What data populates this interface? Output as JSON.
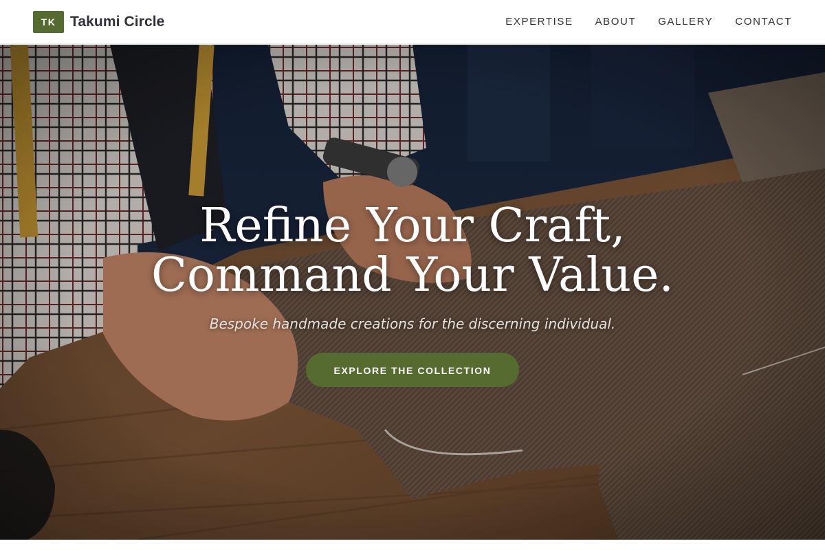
{
  "brand": {
    "logo_text": "TK",
    "name": "Takumi Circle",
    "accent_color": "#556b2f"
  },
  "nav": {
    "items": [
      {
        "label": "EXPERTISE"
      },
      {
        "label": "ABOUT"
      },
      {
        "label": "GALLERY"
      },
      {
        "label": "CONTACT"
      }
    ]
  },
  "hero": {
    "headline_line1": "Refine Your Craft,",
    "headline_line2": "Command Your Value.",
    "subtitle": "Bespoke handmade creations for the discerning individual.",
    "cta_label": "EXPLORE THE COLLECTION"
  }
}
